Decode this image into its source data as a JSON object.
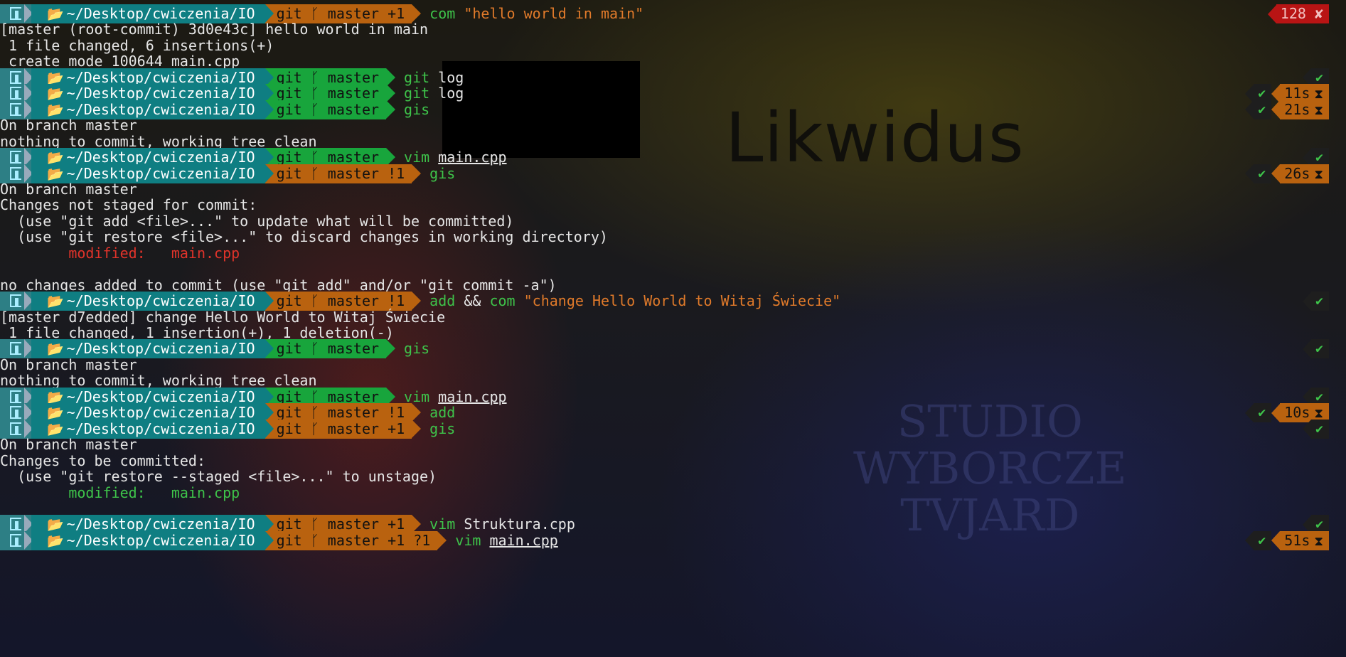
{
  "background": {
    "title": "Likwidus",
    "sign_lines": [
      "STUDIO",
      "WYBORCZE",
      "TVJARD"
    ]
  },
  "prompt": {
    "path": "~/Desktop/cwiczenia/IO",
    "git_label": "git",
    "branch_icon": "branch-icon",
    "folder_icon": "folder-icon",
    "colors": {
      "clean": "#18a53c",
      "dirty": "#b9620f",
      "path_bg": "#0f7e82",
      "error": "#b81414"
    }
  },
  "lines": [
    {
      "type": "prompt",
      "status": "dirty",
      "branch": "master +1",
      "cmd": [
        {
          "t": "com ",
          "c": "green"
        },
        {
          "t": "\"hello world in main\"",
          "c": "orange"
        }
      ],
      "right": {
        "error": "128 ✘"
      }
    },
    {
      "type": "out",
      "text": "[master (root-commit) 3d0e43c] hello world in main"
    },
    {
      "type": "out",
      "text": " 1 file changed, 6 insertions(+)"
    },
    {
      "type": "out",
      "text": " create mode 100644 main.cpp"
    },
    {
      "type": "prompt",
      "status": "clean",
      "branch": "master",
      "cmd": [
        {
          "t": "git ",
          "c": "green"
        },
        {
          "t": "log",
          "c": "white"
        }
      ],
      "right": {
        "ok": "✔"
      }
    },
    {
      "type": "prompt",
      "status": "clean",
      "branch": "master",
      "cmd": [
        {
          "t": "git ",
          "c": "green"
        },
        {
          "t": "log",
          "c": "white"
        }
      ],
      "right": {
        "ok": "✔",
        "time": "11s"
      }
    },
    {
      "type": "prompt",
      "status": "clean",
      "branch": "master",
      "cmd": [
        {
          "t": "gis",
          "c": "green"
        }
      ],
      "right": {
        "ok": "✔",
        "time": "21s"
      }
    },
    {
      "type": "out",
      "text": "On branch master"
    },
    {
      "type": "out",
      "text": "nothing to commit, working tree clean"
    },
    {
      "type": "prompt",
      "status": "clean",
      "branch": "master",
      "cmd": [
        {
          "t": "vim ",
          "c": "green"
        },
        {
          "t": "main.cpp",
          "c": "white",
          "u": true
        }
      ],
      "right": {
        "ok": "✔"
      }
    },
    {
      "type": "prompt",
      "status": "dirty",
      "branch": "master !1",
      "cmd": [
        {
          "t": "gis",
          "c": "green"
        }
      ],
      "right": {
        "ok": "✔",
        "time": "26s"
      }
    },
    {
      "type": "out",
      "text": "On branch master"
    },
    {
      "type": "out",
      "text": "Changes not staged for commit:"
    },
    {
      "type": "out",
      "text": "  (use \"git add <file>...\" to update what will be committed)"
    },
    {
      "type": "out",
      "text": "  (use \"git restore <file>...\" to discard changes in working directory)"
    },
    {
      "type": "out",
      "text": "        modified:   main.cpp",
      "c": "red"
    },
    {
      "type": "out",
      "text": ""
    },
    {
      "type": "out",
      "text": "no changes added to commit (use \"git add\" and/or \"git commit -a\")"
    },
    {
      "type": "prompt",
      "status": "dirty",
      "branch": "master !1",
      "cmd": [
        {
          "t": "add ",
          "c": "green"
        },
        {
          "t": "&& ",
          "c": "white"
        },
        {
          "t": "com ",
          "c": "green"
        },
        {
          "t": "\"change Hello World to Witaj Świecie\"",
          "c": "orange"
        }
      ],
      "right": {
        "ok": "✔"
      }
    },
    {
      "type": "out",
      "text": "[master d7edded] change Hello World to Witaj Świecie"
    },
    {
      "type": "out",
      "text": " 1 file changed, 1 insertion(+), 1 deletion(-)"
    },
    {
      "type": "prompt",
      "status": "clean",
      "branch": "master",
      "cmd": [
        {
          "t": "gis",
          "c": "green"
        }
      ],
      "right": {
        "ok": "✔"
      }
    },
    {
      "type": "out",
      "text": "On branch master"
    },
    {
      "type": "out",
      "text": "nothing to commit, working tree clean"
    },
    {
      "type": "prompt",
      "status": "clean",
      "branch": "master",
      "cmd": [
        {
          "t": "vim ",
          "c": "green"
        },
        {
          "t": "main.cpp",
          "c": "white",
          "u": true
        }
      ],
      "right": {
        "ok": "✔"
      }
    },
    {
      "type": "prompt",
      "status": "dirty",
      "branch": "master !1",
      "cmd": [
        {
          "t": "add",
          "c": "green"
        }
      ],
      "right": {
        "ok": "✔",
        "time": "10s"
      }
    },
    {
      "type": "prompt",
      "status": "dirty",
      "branch": "master +1",
      "cmd": [
        {
          "t": "gis",
          "c": "green"
        }
      ],
      "right": {
        "ok": "✔"
      }
    },
    {
      "type": "out",
      "text": "On branch master"
    },
    {
      "type": "out",
      "text": "Changes to be committed:"
    },
    {
      "type": "out",
      "text": "  (use \"git restore --staged <file>...\" to unstage)"
    },
    {
      "type": "out",
      "text": "        modified:   main.cpp",
      "c": "green"
    },
    {
      "type": "out",
      "text": ""
    },
    {
      "type": "prompt",
      "status": "dirty",
      "branch": "master +1",
      "cmd": [
        {
          "t": "vim ",
          "c": "green"
        },
        {
          "t": "Struktura.cpp",
          "c": "white"
        }
      ],
      "right": {
        "ok": "✔"
      }
    },
    {
      "type": "prompt",
      "status": "dirty",
      "branch": "master +1 ?1",
      "cmd": [
        {
          "t": "vim ",
          "c": "green"
        },
        {
          "t": "main.cpp",
          "c": "white",
          "u": true
        }
      ],
      "right": {
        "ok": "✔",
        "time": "51s"
      }
    }
  ]
}
